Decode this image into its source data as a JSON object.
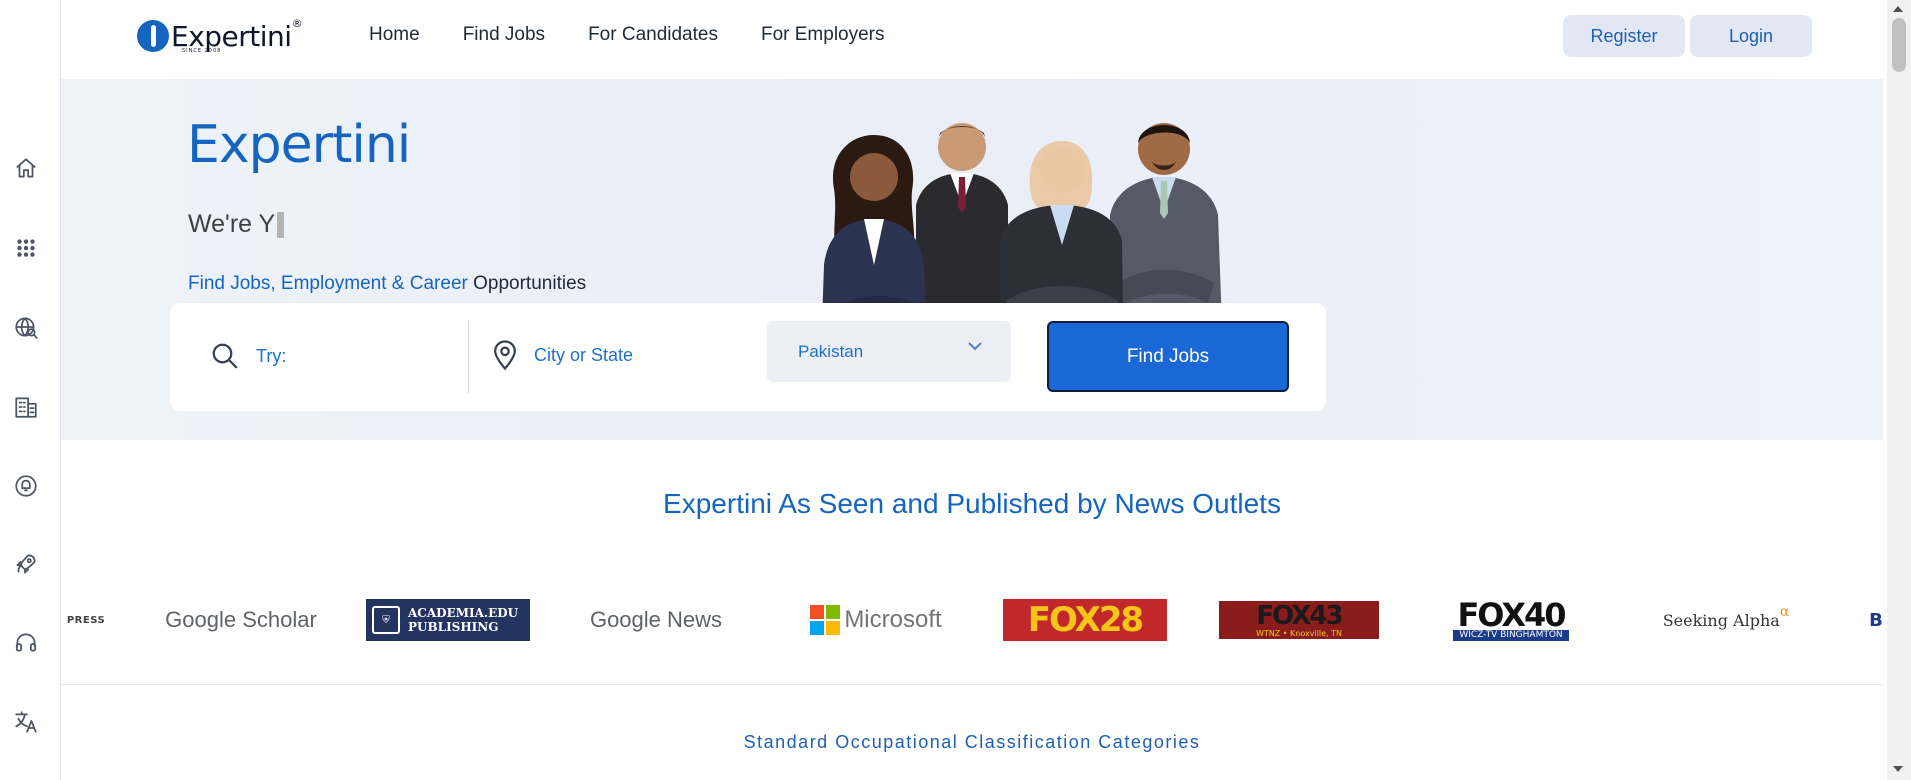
{
  "brand": {
    "name": "Expertini",
    "registered": "®",
    "since": "SINCE 2008"
  },
  "nav": {
    "links": [
      "Home",
      "Find Jobs",
      "For Candidates",
      "For Employers"
    ],
    "register": "Register",
    "login": "Login"
  },
  "sidebar": {
    "icons": [
      "home-icon",
      "apps-grid-icon",
      "globe-search-icon",
      "building-icon",
      "alarm-icon",
      "rocket-icon",
      "headset-icon",
      "translate-icon"
    ]
  },
  "hero": {
    "title": "Expertini",
    "typing_text": "We're Y",
    "tagline_blue": "Find Jobs, Employment & Career",
    "tagline_dark": "Opportunities"
  },
  "search": {
    "what_placeholder": "Try:",
    "where_placeholder": "City or State",
    "country_selected": "Pakistan",
    "find_button": "Find Jobs"
  },
  "news": {
    "heading": "Expertini As Seen and Published by News Outlets",
    "outlets": [
      "PRESS",
      "Google Scholar",
      "ACADEMIA.EDU PUBLISHING",
      "Google News",
      "Microsoft",
      "FOX28",
      "FOX43",
      "FOX40",
      "Seeking Alpha",
      "B"
    ],
    "outlet_details": {
      "fox43_sub": "WTNZ • Knoxville, TN",
      "fox40_sub": "WICZ-TV BINGHAMTON",
      "seeking_alpha_mark": "α"
    }
  },
  "soc": {
    "heading": "Standard Occupational Classification Categories"
  },
  "colors": {
    "brand_blue": "#1565c0",
    "button_blue": "#1a67d6",
    "hero_bg": "#eef2f9",
    "fox_red": "#c0282b",
    "fox_yellow": "#f5c518"
  }
}
